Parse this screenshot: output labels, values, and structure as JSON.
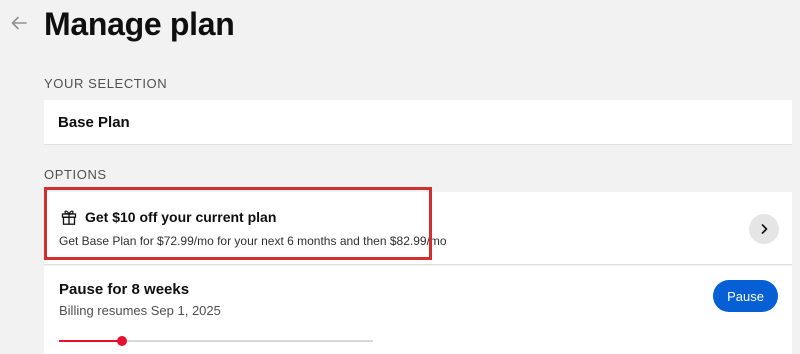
{
  "header": {
    "title": "Manage plan",
    "back_icon": "arrow-left-icon"
  },
  "selection": {
    "section_label": "YOUR SELECTION",
    "plan_name": "Base Plan"
  },
  "options": {
    "section_label": "OPTIONS",
    "offer": {
      "icon": "gift-icon",
      "title": "Get $10 off your current plan",
      "subtitle": "Get Base Plan for $72.99/mo for your next 6 months and then $82.99/mo",
      "action_icon": "chevron-right-icon"
    },
    "pause": {
      "title": "Pause for 8 weeks",
      "subtitle": "Billing resumes Sep 1, 2025",
      "button_label": "Pause",
      "slider_fraction": 0.2
    }
  },
  "colors": {
    "highlight_border": "#d32f2f",
    "primary_button": "#065fd4",
    "slider_accent": "#e8102e"
  }
}
